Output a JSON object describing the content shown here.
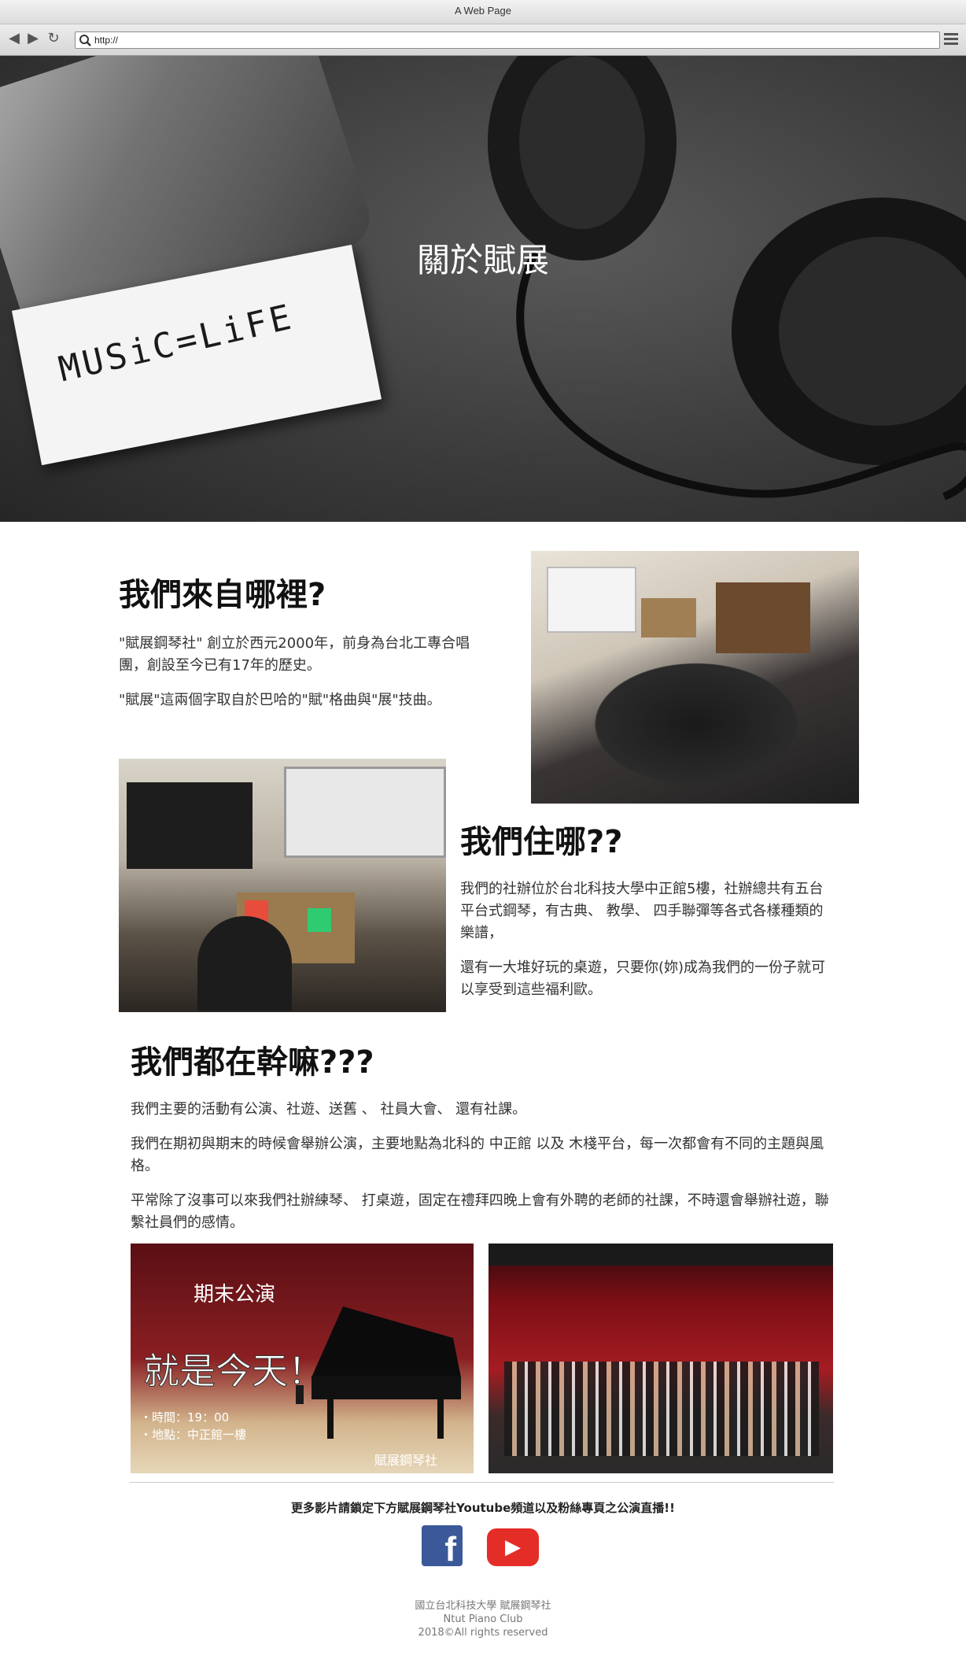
{
  "browser": {
    "window_title": "A Web Page",
    "url": "http://"
  },
  "hero": {
    "title": "關於賦展",
    "card_text": "MUSiC=LiFE"
  },
  "sections": {
    "where_from": {
      "heading": "我們來自哪裡?",
      "paragraphs": [
        "\"賦展鋼琴社\" 創立於西元2000年，前身為台北工專合唱團，創設至今已有17年的歷史。",
        "\"賦展\"這兩個字取自於巴哈的\"賦\"格曲與\"展\"技曲。"
      ]
    },
    "where_live": {
      "heading": "我們住哪??",
      "paragraphs": [
        "我們的社辦位於台北科技大學中正館5樓，社辦總共有五台平台式鋼琴，有古典、 教學、 四手聯彈等各式各樣種類的樂譜，",
        "還有一大堆好玩的桌遊，只要你(妳)成為我們的一份子就可以享受到這些福利歐。"
      ]
    },
    "what_do": {
      "heading": "我們都在幹嘛???",
      "paragraphs": [
        "我們主要的活動有公演、社遊、送舊 、 社員大會、 還有社課。",
        "我們在期初與期末的時候會舉辦公演，主要地點為北科的 中正館 以及 木棧平台，每一次都會有不同的主題與風格。",
        "平常除了沒事可以來我們社辦練琴、 打桌遊，固定在禮拜四晚上會有外聘的老師的社課，不時還會舉辦社遊，聯繫社員們的感情。"
      ]
    }
  },
  "poster": {
    "title": "期末公演",
    "big_text": "就是今天！",
    "time_line": "・時間：19：00",
    "place_line": "・地點：中正館一樓",
    "signature": "賦展鋼琴社"
  },
  "cta": "更多影片請鎖定下方賦展鋼琴社Youtube頻道以及粉絲專頁之公演直播!!",
  "social": {
    "facebook_glyph": "f",
    "youtube_glyph": "▶"
  },
  "footer": {
    "line1": "國立台北科技大學 賦展鋼琴社",
    "line2": "Ntut Piano Club",
    "line3": "2018©All rights reserved"
  },
  "colors": {
    "facebook": "#3b5998",
    "youtube": "#e52d27"
  }
}
